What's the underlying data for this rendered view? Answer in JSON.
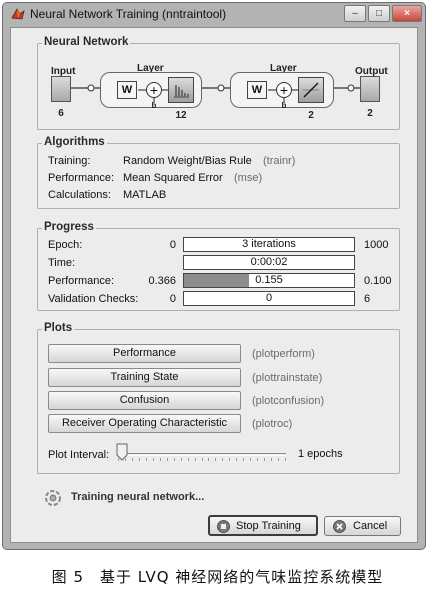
{
  "window": {
    "title": "Neural Network Training (nntraintool)",
    "controls": [
      "–",
      "□",
      "×"
    ]
  },
  "network": {
    "section_title": "Neural Network",
    "input_label": "Input",
    "input_size": "6",
    "layer1": {
      "label": "Layer",
      "w_label": "W",
      "b_label": "b",
      "size": "12"
    },
    "layer2": {
      "label": "Layer",
      "w_label": "W",
      "b_label": "b",
      "size": "2"
    },
    "output_label": "Output",
    "output_size": "2"
  },
  "algorithms": {
    "section_title": "Algorithms",
    "rows": [
      {
        "label": "Training:",
        "value": "Random Weight/Bias Rule",
        "code": "(trainr)"
      },
      {
        "label": "Performance:",
        "value": "Mean Squared Error",
        "code": "(mse)"
      },
      {
        "label": "Calculations:",
        "value": "MATLAB",
        "code": ""
      }
    ]
  },
  "progress": {
    "section_title": "Progress",
    "rows": [
      {
        "label": "Epoch:",
        "start": "0",
        "bar_text": "3 iterations",
        "end": "1000",
        "fill": 0
      },
      {
        "label": "Time:",
        "start": "",
        "bar_text": "0:00:02",
        "end": "",
        "fill": 0
      },
      {
        "label": "Performance:",
        "start": "0.366",
        "bar_text": "0.155",
        "end": "0.100",
        "fill": 0.38
      },
      {
        "label": "Validation Checks:",
        "start": "0",
        "bar_text": "0",
        "end": "6",
        "fill": 0
      }
    ]
  },
  "plots": {
    "section_title": "Plots",
    "buttons": [
      {
        "label": "Performance",
        "code": "(plotperform)"
      },
      {
        "label": "Training State",
        "code": "(plottrainstate)"
      },
      {
        "label": "Confusion",
        "code": "(plotconfusion)"
      },
      {
        "label": "Receiver Operating Characteristic",
        "code": "(plotroc)"
      }
    ],
    "interval_label": "Plot Interval:",
    "interval_value": "1 epochs"
  },
  "status": {
    "text": "Training neural network..."
  },
  "footer": {
    "stop_label": "Stop Training",
    "cancel_label": "Cancel"
  },
  "caption": "图 5　基于 LVQ 神经网络的气味监控系统模型",
  "colors": {
    "background": "#ececec",
    "frame": "#b3b3b3",
    "bar_fill": "#8c8c8c"
  }
}
